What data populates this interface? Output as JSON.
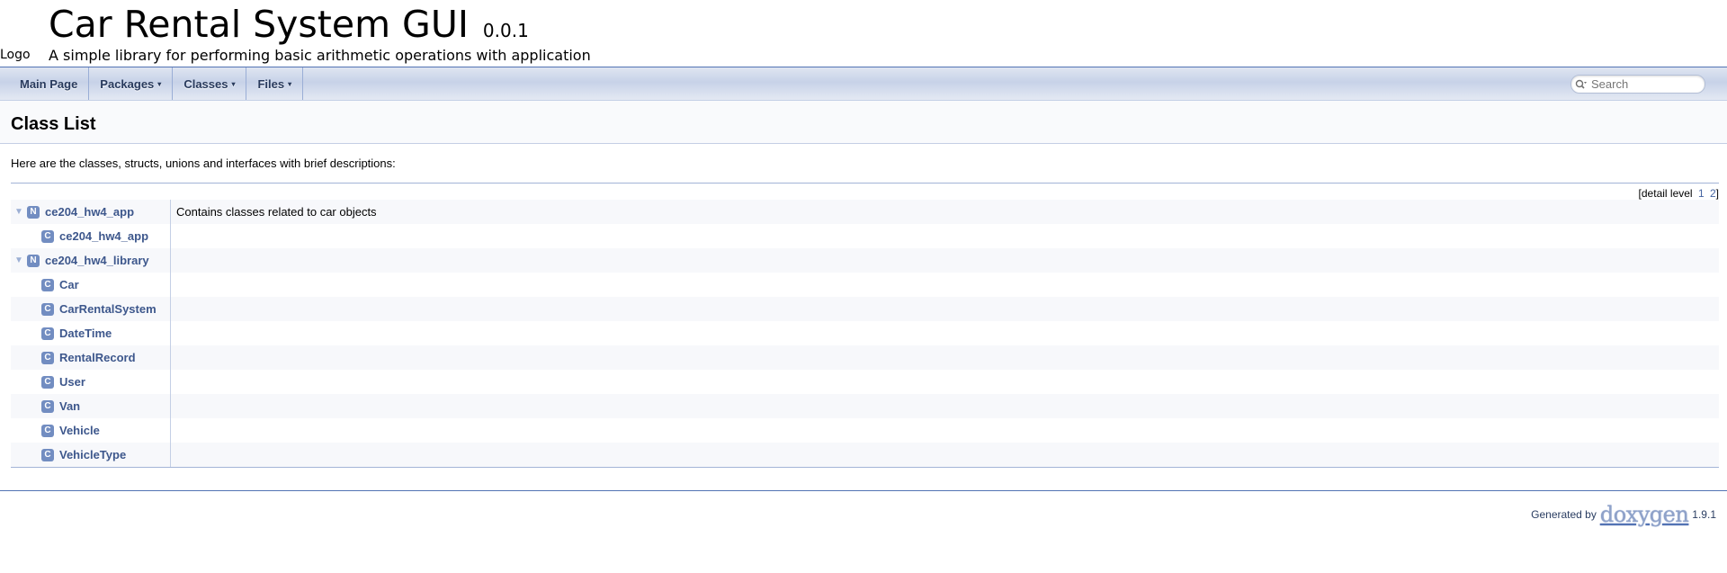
{
  "project": {
    "name": "Car Rental System GUI",
    "number": "0.0.1",
    "logo_alt": "Logo",
    "brief": "A simple library for performing basic arithmetic operations with application"
  },
  "nav": {
    "items": [
      {
        "label": "Main Page"
      },
      {
        "label": "Packages",
        "caret": "▾"
      },
      {
        "label": "Classes",
        "caret": "▾"
      },
      {
        "label": "Files",
        "caret": "▾"
      }
    ],
    "search_placeholder": "Search"
  },
  "header": {
    "title": "Class List"
  },
  "contents": {
    "intro": "Here are the classes, structs, unions and interfaces with brief descriptions:",
    "detail_level_label": "[detail level",
    "detail_levels": [
      "1",
      "2"
    ],
    "detail_level_close": "]"
  },
  "tree": [
    {
      "kind": "N",
      "name": "ce204_hw4_app",
      "desc": "Contains classes related to car objects",
      "arrow": "▼"
    },
    {
      "kind": "C",
      "name": "ce204_hw4_app",
      "desc": ""
    },
    {
      "kind": "N",
      "name": "ce204_hw4_library",
      "desc": "",
      "arrow": "▼"
    },
    {
      "kind": "C",
      "name": "Car",
      "desc": ""
    },
    {
      "kind": "C",
      "name": "CarRentalSystem",
      "desc": ""
    },
    {
      "kind": "C",
      "name": "DateTime",
      "desc": ""
    },
    {
      "kind": "C",
      "name": "RentalRecord",
      "desc": ""
    },
    {
      "kind": "C",
      "name": "User",
      "desc": ""
    },
    {
      "kind": "C",
      "name": "Van",
      "desc": ""
    },
    {
      "kind": "C",
      "name": "Vehicle",
      "desc": ""
    },
    {
      "kind": "C",
      "name": "VehicleType",
      "desc": ""
    }
  ],
  "footer": {
    "generated_by": "Generated by",
    "brand": "doxygen",
    "version": "1.9.1"
  }
}
